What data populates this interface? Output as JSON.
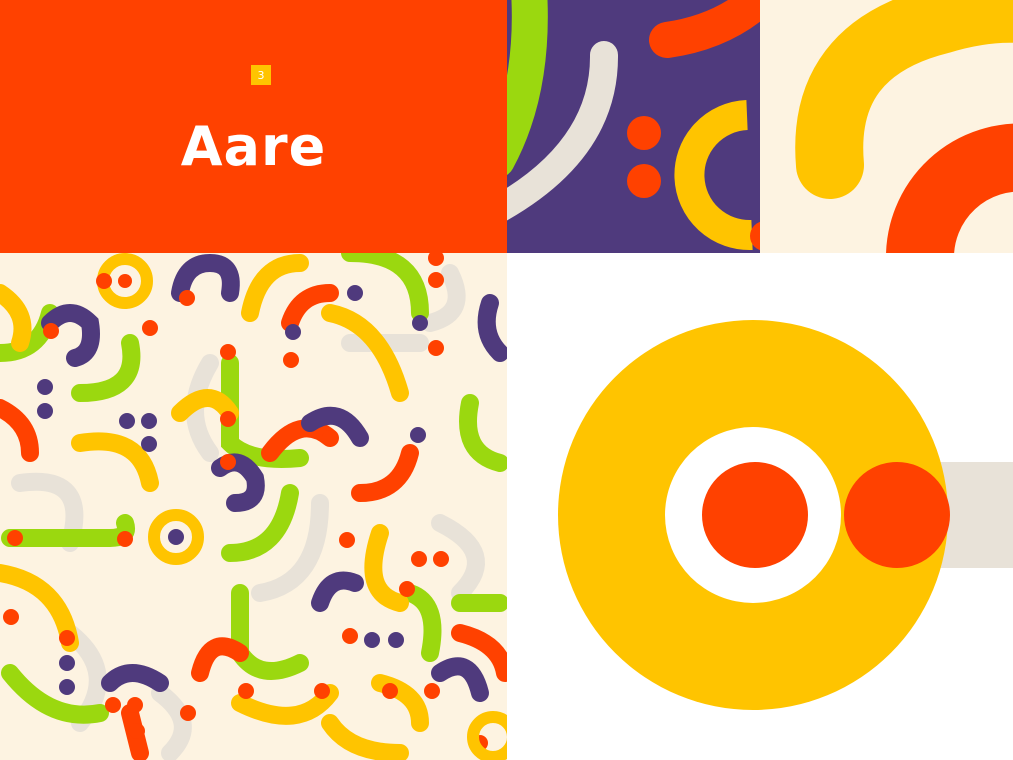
{
  "brand": {
    "badge_text": "3",
    "wordmark": "Aare"
  },
  "colors": {
    "orange_red": "#ff4100",
    "purple": "#4f3a7d",
    "yellow": "#ffc400",
    "green": "#9bd80f",
    "cream": "#fdf3e1",
    "beige": "#e8e2d8",
    "white": "#ffffff"
  }
}
